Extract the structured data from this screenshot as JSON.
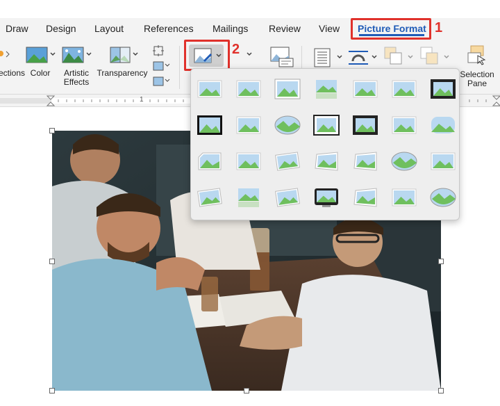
{
  "tabs": [
    "Draw",
    "Design",
    "Layout",
    "References",
    "Mailings",
    "Review",
    "View"
  ],
  "active_tab": "Picture Format",
  "callouts": {
    "one": "1",
    "two": "2"
  },
  "ribbon": {
    "corrections": "ections",
    "color": "Color",
    "artistic_effects_line1": "Artistic",
    "artistic_effects_line2": "Effects",
    "transparency": "Transparency",
    "selection_pane_line1": "Selection",
    "selection_pane_line2": "Pane"
  },
  "ruler_mark": "1",
  "picture_styles": {
    "rows": 4,
    "columns": 7,
    "selected_index": 6
  },
  "colors": {
    "accent": "#1f5bb7",
    "callout": "#e0312b",
    "ribbon": "#f3f3f3"
  }
}
